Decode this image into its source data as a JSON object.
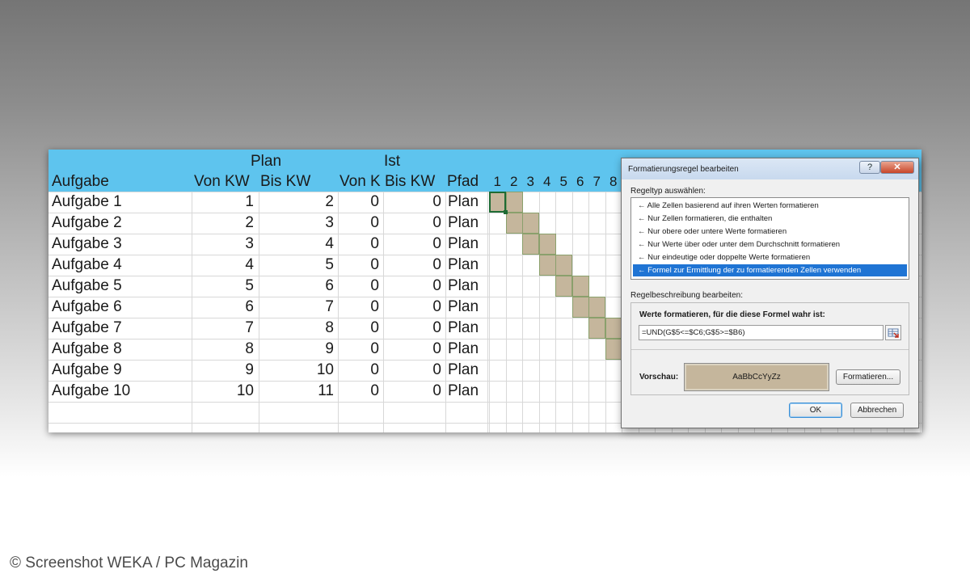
{
  "sheet": {
    "group_headers": {
      "plan": "Plan",
      "ist": "Ist"
    },
    "columns": [
      "Aufgabe",
      "Von KW",
      "Bis KW",
      "Von K",
      "Bis KW",
      "Pfad"
    ],
    "week_numbers": [
      "1",
      "2",
      "3",
      "4",
      "5",
      "6",
      "7",
      "8"
    ],
    "rows": [
      {
        "task": "Aufgabe 1",
        "plan_von": "1",
        "plan_bis": "2",
        "ist_von": "0",
        "ist_bis": "0",
        "pfad": "Plan"
      },
      {
        "task": "Aufgabe 2",
        "plan_von": "2",
        "plan_bis": "3",
        "ist_von": "0",
        "ist_bis": "0",
        "pfad": "Plan"
      },
      {
        "task": "Aufgabe 3",
        "plan_von": "3",
        "plan_bis": "4",
        "ist_von": "0",
        "ist_bis": "0",
        "pfad": "Plan"
      },
      {
        "task": "Aufgabe 4",
        "plan_von": "4",
        "plan_bis": "5",
        "ist_von": "0",
        "ist_bis": "0",
        "pfad": "Plan"
      },
      {
        "task": "Aufgabe 5",
        "plan_von": "5",
        "plan_bis": "6",
        "ist_von": "0",
        "ist_bis": "0",
        "pfad": "Plan"
      },
      {
        "task": "Aufgabe 6",
        "plan_von": "6",
        "plan_bis": "7",
        "ist_von": "0",
        "ist_bis": "0",
        "pfad": "Plan"
      },
      {
        "task": "Aufgabe 7",
        "plan_von": "7",
        "plan_bis": "8",
        "ist_von": "0",
        "ist_bis": "0",
        "pfad": "Plan"
      },
      {
        "task": "Aufgabe 8",
        "plan_von": "8",
        "plan_bis": "9",
        "ist_von": "0",
        "ist_bis": "0",
        "pfad": "Plan"
      },
      {
        "task": "Aufgabe 9",
        "plan_von": "9",
        "plan_bis": "10",
        "ist_von": "0",
        "ist_bis": "0",
        "pfad": "Plan"
      },
      {
        "task": "Aufgabe 10",
        "plan_von": "10",
        "plan_bis": "11",
        "ist_von": "0",
        "ist_bis": "0",
        "pfad": "Plan"
      }
    ],
    "colors": {
      "header_bg": "#5ec4ee",
      "gantt_fill": "#c5b69c"
    }
  },
  "dialog": {
    "title": "Formatierungsregel bearbeiten",
    "help_label": "?",
    "close_label": "✕",
    "ruletype_label": "Regeltyp auswählen:",
    "rule_types": [
      "Alle Zellen basierend auf ihren Werten formatieren",
      "Nur Zellen formatieren, die enthalten",
      "Nur obere oder untere Werte formatieren",
      "Nur Werte über oder unter dem Durchschnitt formatieren",
      "Nur eindeutige oder doppelte Werte formatieren",
      "Formel zur Ermittlung der zu formatierenden Zellen verwenden"
    ],
    "selected_rule_index": 5,
    "description_label": "Regelbeschreibung bearbeiten:",
    "formula_label": "Werte formatieren, für die diese Formel wahr ist:",
    "formula_value": "=UND(G$5<=$C6;G$5>=$B6)",
    "preview_label": "Vorschau:",
    "preview_text": "AaBbCcYyZz",
    "format_button": "Formatieren...",
    "ok_button": "OK",
    "cancel_button": "Abbrechen"
  },
  "copyright": "© Screenshot WEKA / PC Magazin"
}
